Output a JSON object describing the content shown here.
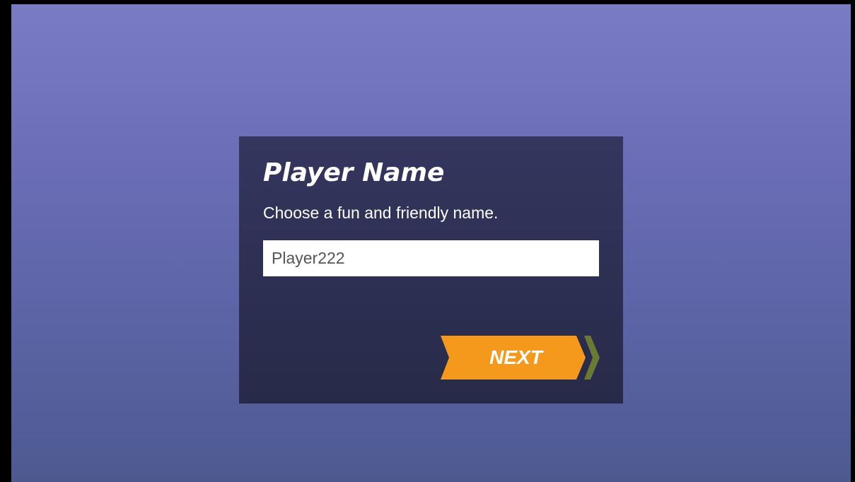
{
  "dialog": {
    "title": "Player Name",
    "subtitle": "Choose a fun and friendly name.",
    "name_input": {
      "value": "Player222",
      "placeholder": ""
    },
    "next_button": {
      "label": "NEXT",
      "icon": "chevron-right-icon"
    }
  },
  "colors": {
    "background_top": "#7a7bc5",
    "background_bottom": "#4d5a90",
    "panel": "#2c2f51",
    "accent_button": "#f5991c",
    "chevron": "#6b7a33",
    "text": "#ffffff"
  }
}
